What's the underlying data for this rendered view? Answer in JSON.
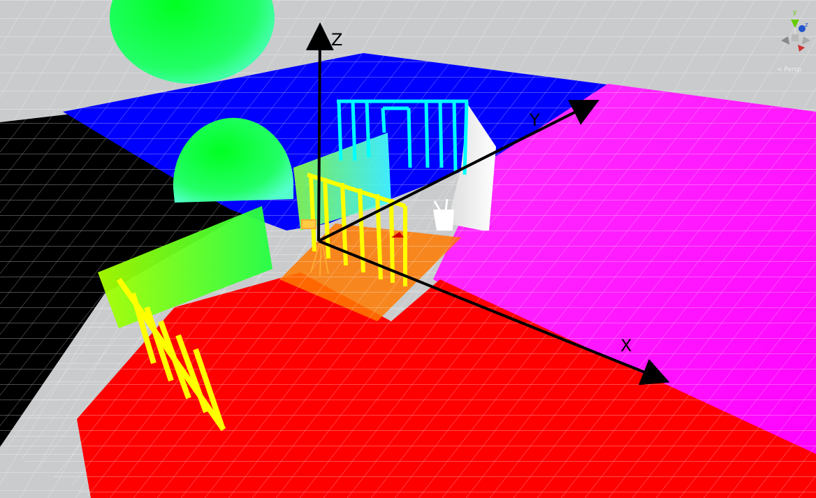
{
  "axes": {
    "x_label": "X",
    "y_label": "Y",
    "z_label": "Z"
  },
  "gizmo": {
    "y_label": "y",
    "z_label": "z",
    "mode_label": "< Persp"
  },
  "colors": {
    "sky_grid": "#c9cbcd",
    "floor_red": "#ff0000",
    "floor_magenta": "#ff00ff",
    "floor_blue": "#0000ff",
    "floor_black": "#000000",
    "sphere_green": "#00ff33",
    "axis_black": "#000000",
    "wall_yellow": "#ffff00",
    "wall_cyan": "#00ffff",
    "wall_green": "#66ff00"
  }
}
